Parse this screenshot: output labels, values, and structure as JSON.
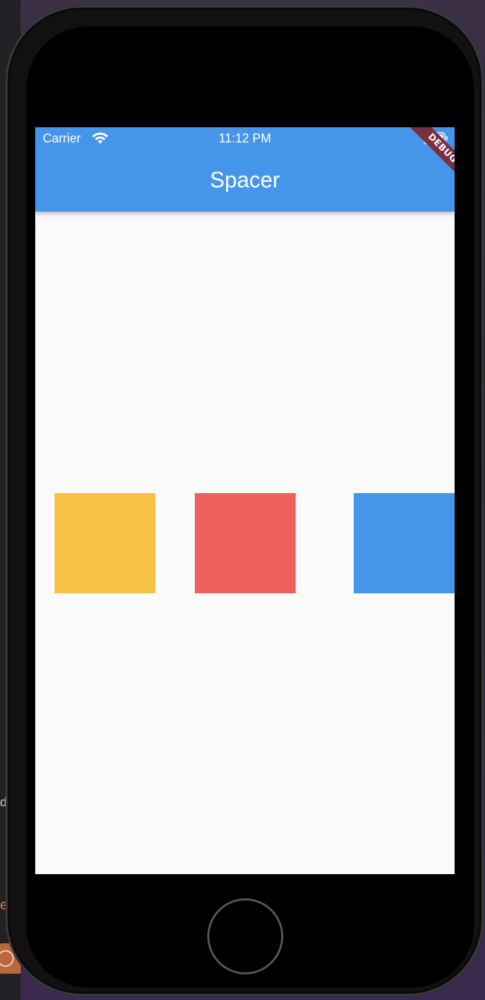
{
  "status_bar": {
    "carrier": "Carrier",
    "time": "11:12 PM",
    "wifi_icon": "wifi-icon",
    "battery_icon": "battery-icon"
  },
  "app_bar": {
    "title": "Spacer",
    "color": "#4596ea"
  },
  "debug_banner": {
    "label": "DEBUG",
    "color": "#7a2f3f"
  },
  "boxes": [
    {
      "color": "#f6c244"
    },
    {
      "color": "#ed605b"
    },
    {
      "color": "#4596ea"
    }
  ],
  "background_fragments": {
    "left_text_1": "d",
    "left_text_2": "e"
  },
  "screen_background": "#fafafa"
}
